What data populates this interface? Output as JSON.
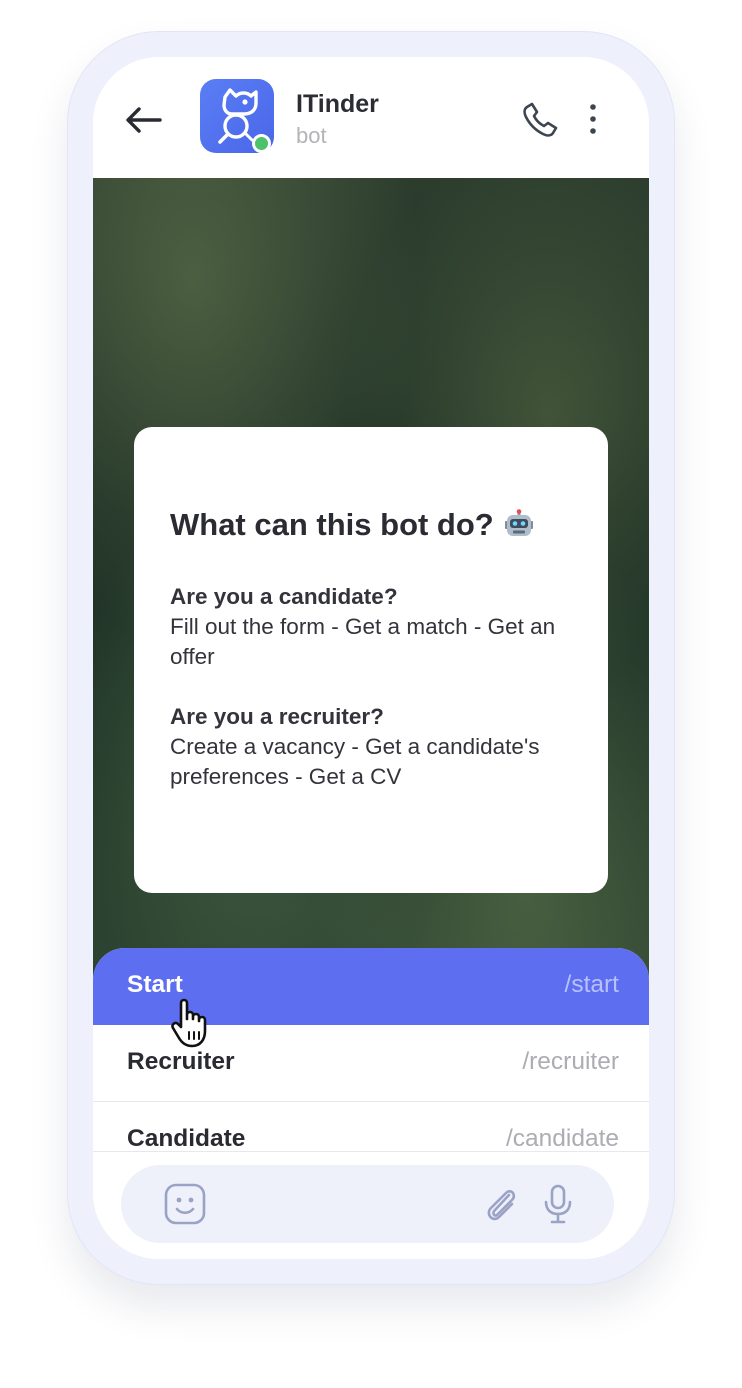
{
  "header": {
    "title": "ITinder",
    "subtitle": "bot",
    "icons": {
      "back": "arrow-left-icon",
      "avatar": "itinder-logo",
      "call": "phone-icon",
      "more": "more-vertical-icon"
    },
    "online_color": "#4cc26a"
  },
  "info_card": {
    "title": "What can this bot do?",
    "title_emoji": "robot-emoji",
    "candidate_heading": "Are you a candidate?",
    "candidate_text": "Fill out the form - Get a match - Get an offer",
    "recruiter_heading": "Are you a recruiter?",
    "recruiter_text": "Create a vacancy - Get a candidate's preferences - Get a CV"
  },
  "commands": [
    {
      "label": "Start",
      "command": "/start",
      "active": true
    },
    {
      "label": "Recruiter",
      "command": "/recruiter",
      "active": false
    },
    {
      "label": "Candidate",
      "command": "/candidate",
      "active": false
    }
  ],
  "input_bar": {
    "icons": {
      "emoji": "smiley-icon",
      "attach": "paperclip-icon",
      "mic": "microphone-icon"
    }
  },
  "colors": {
    "accent": "#5d6ff0",
    "avatar_bg": "#4f6ef0"
  }
}
